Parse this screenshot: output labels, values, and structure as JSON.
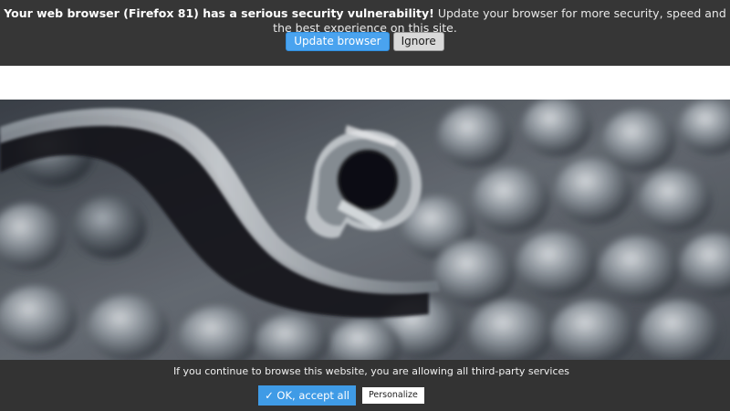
{
  "update_bar": {
    "message_bold": "Your web browser (Firefox 81) has a serious security vulnerability!",
    "message_rest": " Update your browser for more security, speed and the best experience on this site.",
    "update_button": "Update browser",
    "ignore_button": "Ignore"
  },
  "hero": {
    "image": "metallic-gear-closeup"
  },
  "cookie_banner": {
    "text": "If you continue to browse this website, you are allowing all third-party services",
    "ok_button": "✓ OK, accept all",
    "personalize_button": "Personalize"
  }
}
